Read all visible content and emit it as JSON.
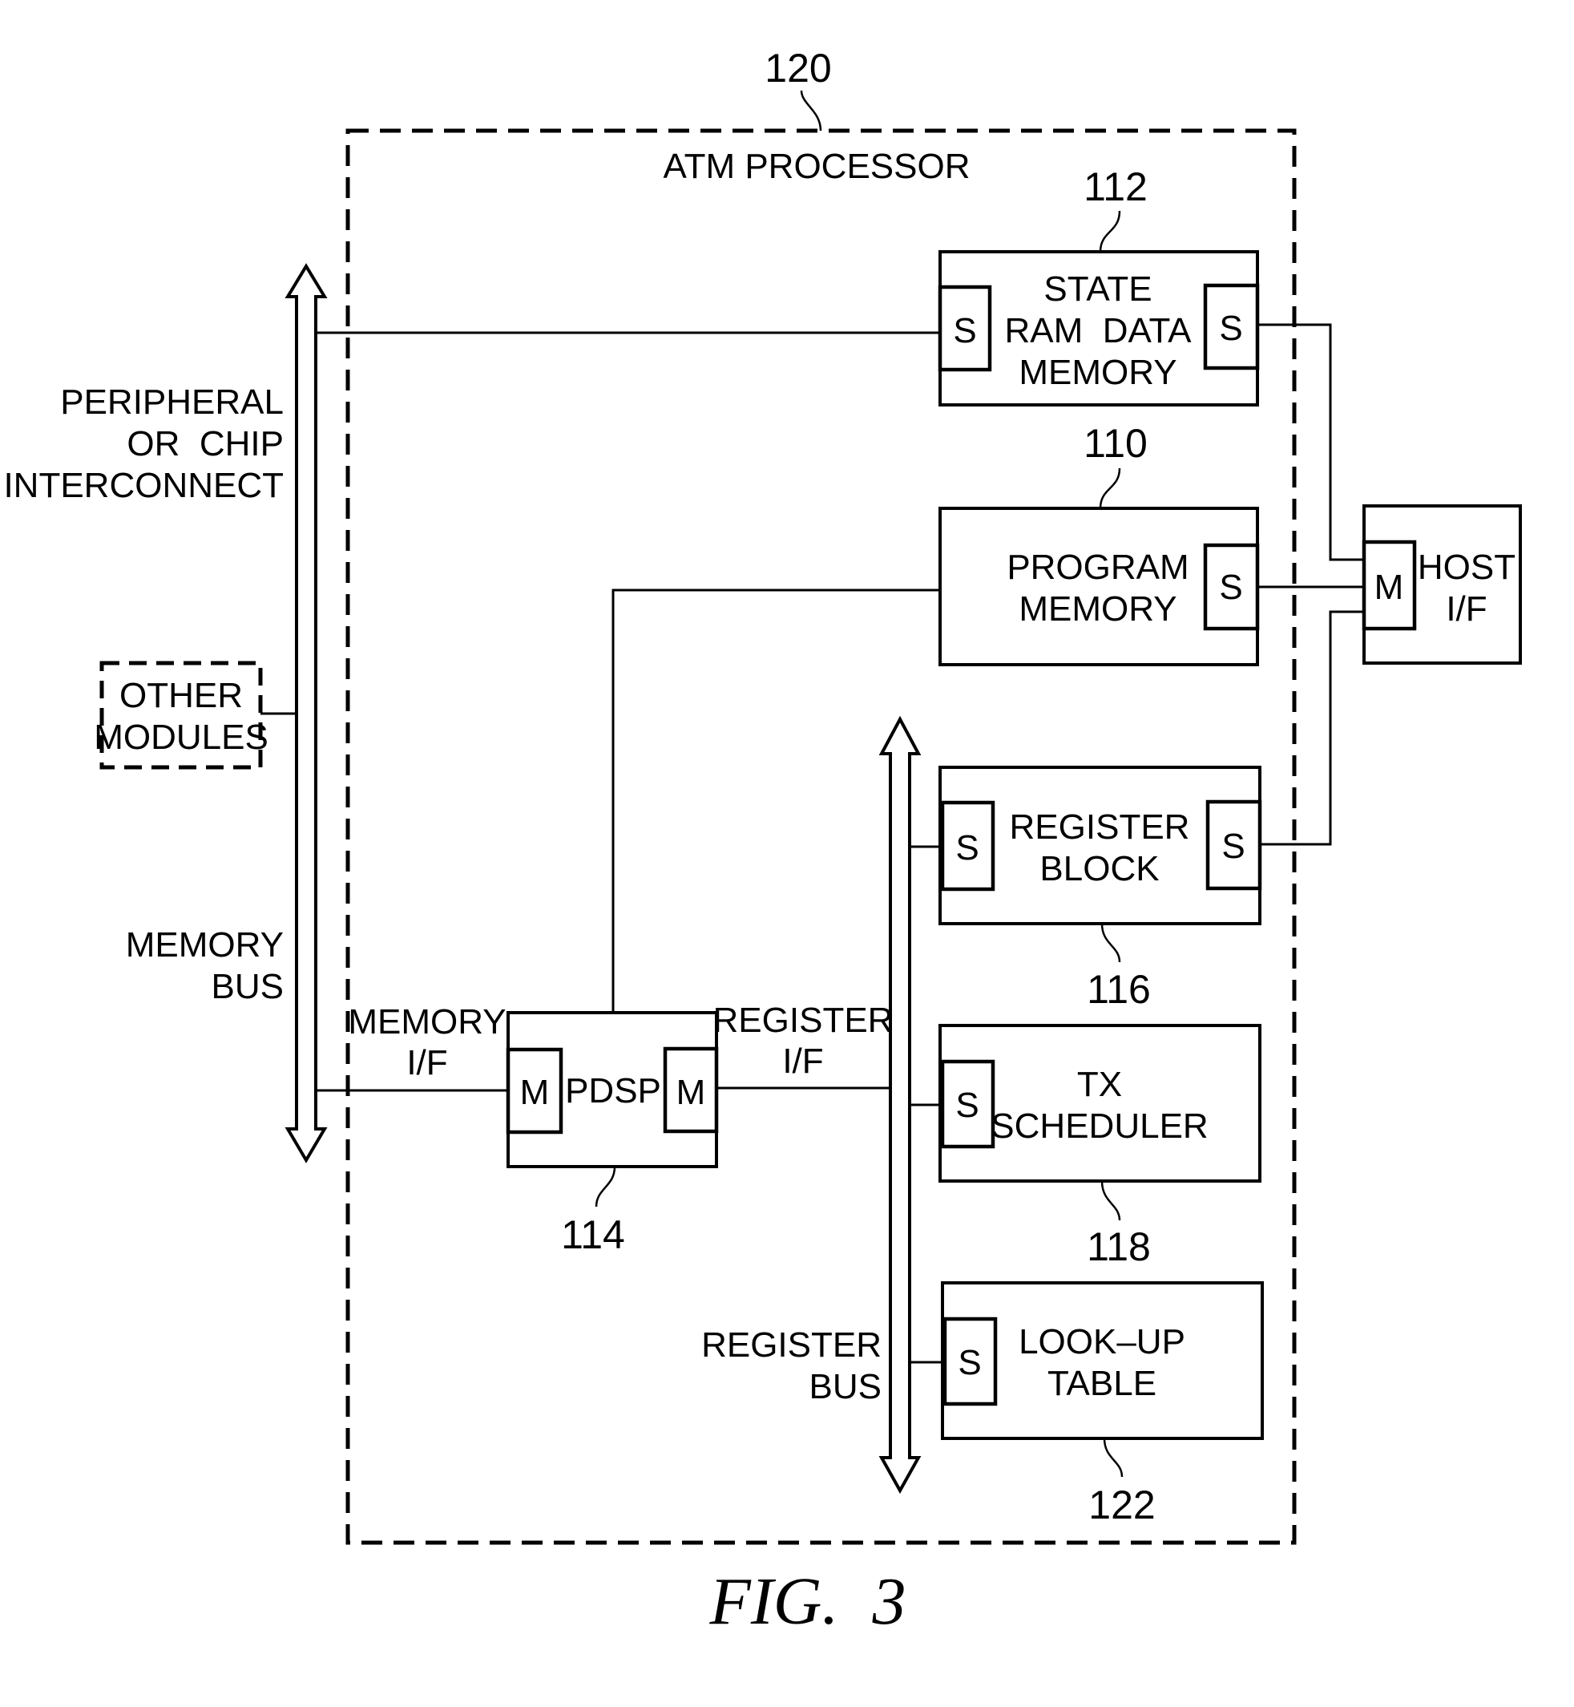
{
  "figure": {
    "caption": "FIG.  3",
    "container": {
      "label": "ATM PROCESSOR",
      "ref": "120"
    }
  },
  "external": {
    "peripheral_bus_label": [
      "PERIPHERAL",
      "OR  CHIP",
      "INTERCONNECT"
    ],
    "memory_bus_label": [
      "MEMORY",
      "BUS"
    ],
    "other_modules": [
      "OTHER",
      "MODULES"
    ],
    "host_if": {
      "label": [
        "HOST",
        "I/F"
      ],
      "port": "M"
    }
  },
  "blocks": {
    "state_ram": {
      "label": [
        "STATE",
        "RAM  DATA",
        "MEMORY"
      ],
      "ref": "112",
      "port_left": "S",
      "port_right": "S"
    },
    "program_memory": {
      "label": [
        "PROGRAM",
        "MEMORY"
      ],
      "ref": "110",
      "port_right": "S"
    },
    "register_block": {
      "label": [
        "REGISTER",
        "BLOCK"
      ],
      "ref": "116",
      "port_left": "S",
      "port_right": "S"
    },
    "tx_scheduler": {
      "label": [
        "TX",
        "SCHEDULER"
      ],
      "ref": "118",
      "port_left": "S"
    },
    "lookup_table": {
      "label": [
        "LOOK–UP",
        "TABLE"
      ],
      "ref": "122",
      "port_left": "S"
    },
    "pdsp": {
      "label": "PDSP",
      "ref": "114",
      "port_left": "M",
      "port_right": "M"
    }
  },
  "connections": {
    "memory_if_label": [
      "MEMORY",
      "I/F"
    ],
    "register_if_label": [
      "REGISTER",
      "I/F"
    ],
    "register_bus_label": [
      "REGISTER",
      "BUS"
    ]
  }
}
